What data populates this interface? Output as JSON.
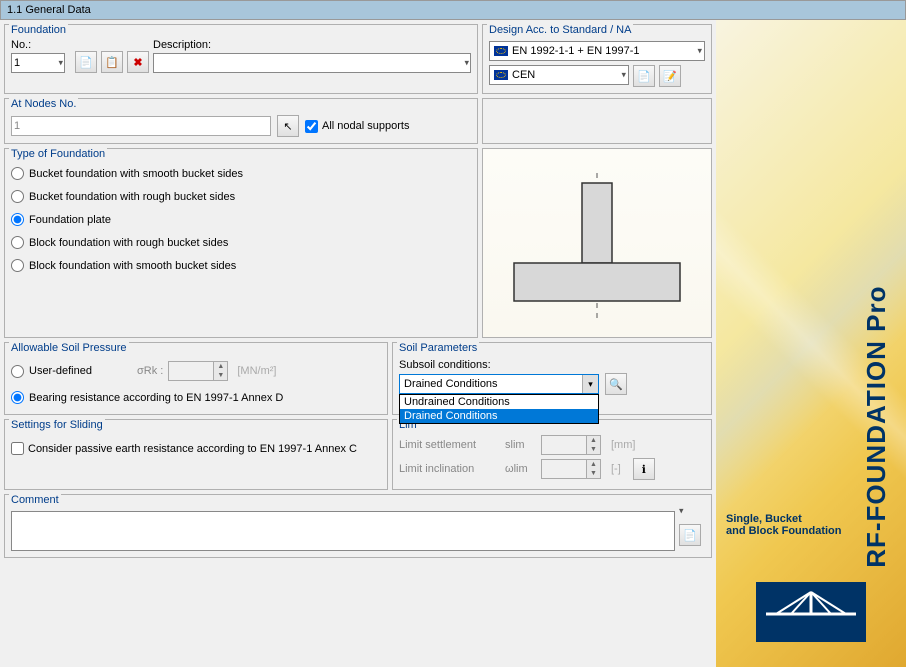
{
  "title_bar": "1.1 General Data",
  "foundation": {
    "group": "Foundation",
    "no_label": "No.:",
    "no_value": "1",
    "desc_label": "Description:",
    "desc_value": ""
  },
  "standard": {
    "group": "Design Acc. to Standard / NA",
    "std_value": "EN 1992-1-1 + EN 1997-1",
    "na_value": "CEN"
  },
  "nodes": {
    "group": "At Nodes No.",
    "value": "1",
    "checkbox_label": "All nodal supports"
  },
  "foundation_type": {
    "group": "Type of Foundation",
    "options": [
      "Bucket foundation with smooth bucket sides",
      "Bucket foundation with rough bucket sides",
      "Foundation plate",
      "Block foundation with rough bucket sides",
      "Block foundation with smooth bucket sides"
    ],
    "selected_index": 2
  },
  "allowable": {
    "group": "Allowable Soil Pressure",
    "user_defined": "User-defined",
    "sigma_label": "σRk :",
    "sigma_unit": "[MN/m²]",
    "bearing": "Bearing resistance according to EN 1997-1 Annex D"
  },
  "soil": {
    "group": "Soil Parameters",
    "subsoil_label": "Subsoil conditions:",
    "selected": "Drained Conditions",
    "options": [
      "Undrained Conditions",
      "Drained Conditions"
    ]
  },
  "limit": {
    "group_abbrev": "Lim",
    "settlement_label": "Limit settlement",
    "settlement_sym": "slim",
    "settlement_unit": "[mm]",
    "inclination_label": "Limit inclination",
    "inclination_sym": "ωlim",
    "inclination_unit": "[-]"
  },
  "sliding": {
    "group": "Settings for Sliding",
    "checkbox_label": "Consider passive earth resistance according to EN 1997-1 Annex C"
  },
  "comment": {
    "group": "Comment",
    "value": ""
  },
  "branding": {
    "product": "RF-FOUNDATION Pro",
    "subtitle1": "Single, Bucket",
    "subtitle2": "and Block Foundation"
  }
}
